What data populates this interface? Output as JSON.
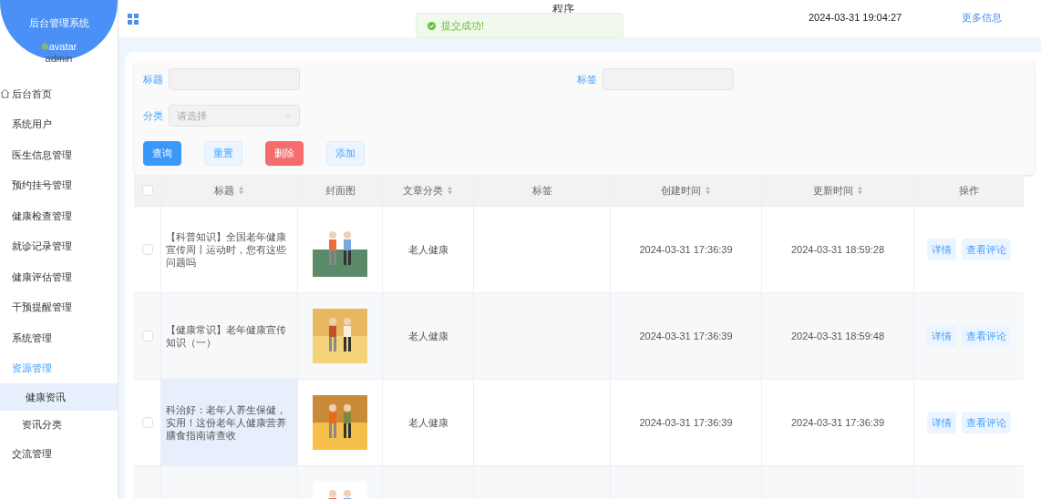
{
  "sidebar": {
    "title": "后台管理系统",
    "avatar_alt": "avatar",
    "username": "admin",
    "items": [
      {
        "label": "后台首页",
        "selected": false
      },
      {
        "label": "系统用户",
        "selected": false
      },
      {
        "label": "医生信息管理",
        "selected": false
      },
      {
        "label": "预约挂号管理",
        "selected": false
      },
      {
        "label": "健康检查管理",
        "selected": false
      },
      {
        "label": "就诊记录管理",
        "selected": false
      },
      {
        "label": "健康评估管理",
        "selected": false
      },
      {
        "label": "干预提醒管理",
        "selected": false
      },
      {
        "label": "系统管理",
        "selected": false
      },
      {
        "label": "资源管理",
        "selected": true,
        "expanded": true,
        "children": [
          {
            "label": "健康资讯",
            "selected": true
          },
          {
            "label": "资讯分类",
            "selected": false
          }
        ]
      },
      {
        "label": "交流管理",
        "selected": false
      }
    ]
  },
  "header": {
    "title": "程序",
    "datetime": "2024-03-31 19:04:27",
    "more_link": "更多信息"
  },
  "toast": {
    "kind": "success",
    "message": "提交成功!"
  },
  "search": {
    "fields": [
      {
        "kind": "input",
        "label": "标题"
      },
      {
        "kind": "input",
        "label": "标签"
      },
      {
        "kind": "select",
        "label": "分类",
        "placeholder": "请选择"
      }
    ],
    "buttons": [
      {
        "kind": "primary",
        "label": "查询"
      },
      {
        "kind": "plain",
        "label": "重置"
      },
      {
        "kind": "danger",
        "label": "删除"
      },
      {
        "kind": "plain",
        "label": "添加"
      }
    ]
  },
  "table": {
    "all_checked": false,
    "columns": [
      {
        "label": "标题",
        "sortable": true
      },
      {
        "label": "封面图",
        "sortable": false
      },
      {
        "label": "文章分类",
        "sortable": true
      },
      {
        "label": "标签",
        "sortable": false
      },
      {
        "label": "创建时间",
        "sortable": true
      },
      {
        "label": "更新时间",
        "sortable": true
      },
      {
        "label": "操作",
        "sortable": false
      }
    ],
    "rows": [
      {
        "checked": false,
        "hovered": false,
        "title": "【科普知识】全国老年健康宣传周丨运动时，您有这些问题吗",
        "cover": {
          "kind": "picture"
        },
        "category": "老人健康",
        "created": "2024-03-31 17:36:39",
        "updated": "2024-03-31 18:59:28",
        "actions": [
          "详情",
          "查看评论"
        ]
      },
      {
        "checked": false,
        "hovered": false,
        "title": "【健康常识】老年健康宣传知识（一）",
        "cover": {
          "kind": "picture"
        },
        "category": "老人健康",
        "created": "2024-03-31 17:36:39",
        "updated": "2024-03-31 18:59:48",
        "actions": [
          "详情",
          "查看评论"
        ]
      },
      {
        "checked": false,
        "hovered": true,
        "title": "科治好：老年人养生保健，实用！这份老年人健康营养膳食指南请查收",
        "cover": {
          "kind": "picture"
        },
        "category": "老人健康",
        "created": "2024-03-31 17:36:39",
        "updated": "2024-03-31 17:36:39",
        "actions": [
          "详情",
          "查看评论"
        ]
      },
      {
        "cover": {
          "kind": "picture"
        }
      }
    ]
  }
}
